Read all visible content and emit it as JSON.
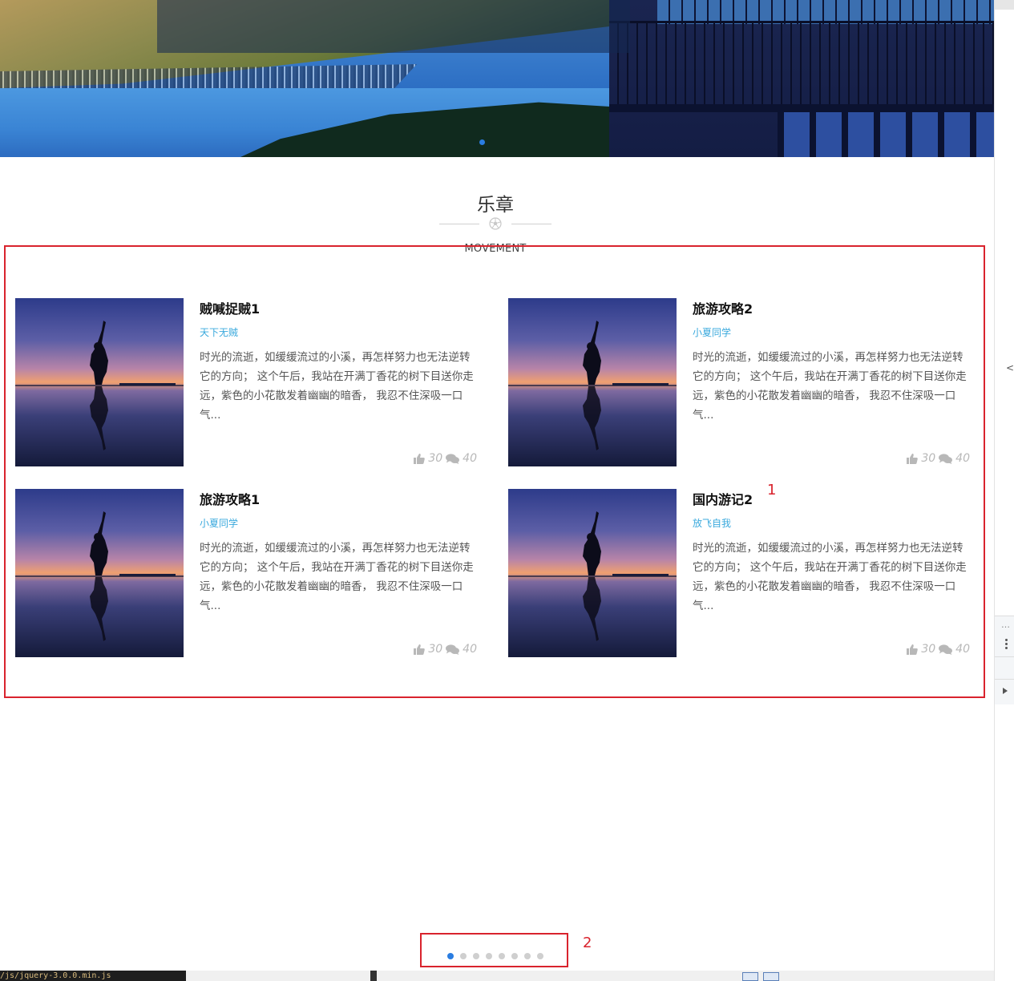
{
  "section": {
    "title": "乐章",
    "subtitle": "MOVEMENT"
  },
  "cards": [
    {
      "title": "贼喊捉贼1",
      "author": "天下无贼",
      "description": "时光的流逝，如缓缓流过的小溪，再怎样努力也无法逆转它的方向； 这个午后，我站在开满丁香花的树下目送你走远，紫色的小花散发着幽幽的暗香， 我忍不住深吸一口气...",
      "likes": "30",
      "comments": "40"
    },
    {
      "title": "旅游攻略2",
      "author": "小夏同学",
      "description": "时光的流逝，如缓缓流过的小溪，再怎样努力也无法逆转它的方向； 这个午后，我站在开满丁香花的树下目送你走远，紫色的小花散发着幽幽的暗香， 我忍不住深吸一口气...",
      "likes": "30",
      "comments": "40"
    },
    {
      "title": "旅游攻略1",
      "author": "小夏同学",
      "description": "时光的流逝，如缓缓流过的小溪，再怎样努力也无法逆转它的方向； 这个午后，我站在开满丁香花的树下目送你走远，紫色的小花散发着幽幽的暗香， 我忍不住深吸一口气...",
      "likes": "30",
      "comments": "40"
    },
    {
      "title": "国内游记2",
      "author": "放飞自我",
      "description": "时光的流逝，如缓缓流过的小溪，再怎样努力也无法逆转它的方向； 这个午后，我站在开满丁香花的树下目送你走远，紫色的小花散发着幽幽的暗香， 我忍不住深吸一口气...",
      "likes": "30",
      "comments": "40"
    }
  ],
  "annotations": {
    "box1_label": "1",
    "box2_label": "2"
  },
  "pagination": {
    "total_pages": 8,
    "active_page": 1
  },
  "colors": {
    "accent": "#2a7de1",
    "author_link": "#3aa9dd",
    "annotation": "#d9232d",
    "stats": "#b8b8b8"
  },
  "icons": {
    "likes": "thumbs-up-icon",
    "comments": "comments-icon",
    "ornament": "soccer-ball-icon"
  },
  "taskbar": {
    "code_snippet": "/js/jquery-3.0.0.min.js"
  }
}
